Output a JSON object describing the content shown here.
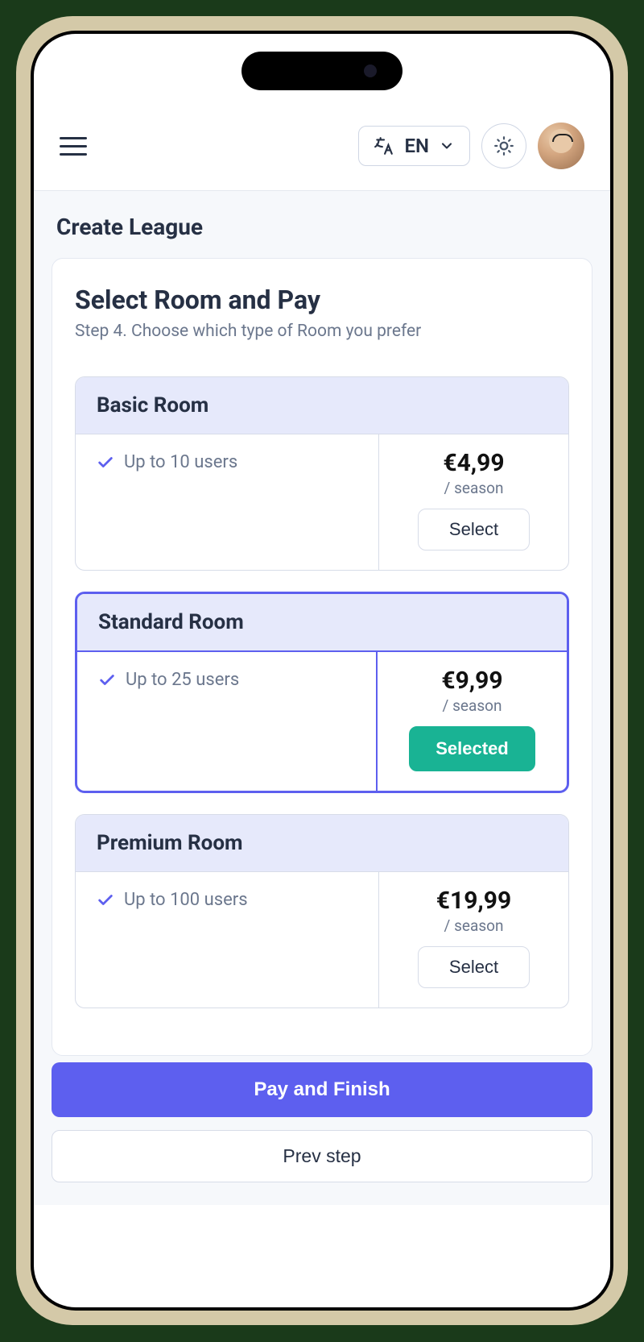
{
  "header": {
    "language": "EN"
  },
  "page_title": "Create League",
  "card": {
    "title": "Select Room and Pay",
    "step_text": "Step 4. Choose which type of Room you prefer"
  },
  "plans": [
    {
      "name": "Basic Room",
      "feature": "Up to 10 users",
      "price": "€4,99",
      "period": "/ season",
      "button": "Select",
      "selected": false
    },
    {
      "name": "Standard Room",
      "feature": "Up to 25 users",
      "price": "€9,99",
      "period": "/ season",
      "button": "Selected",
      "selected": true
    },
    {
      "name": "Premium Room",
      "feature": "Up to 100 users",
      "price": "€19,99",
      "period": "/ season",
      "button": "Select",
      "selected": false
    }
  ],
  "actions": {
    "primary": "Pay and Finish",
    "secondary": "Prev step"
  },
  "colors": {
    "accent": "#5d5fef",
    "success": "#19b394"
  }
}
